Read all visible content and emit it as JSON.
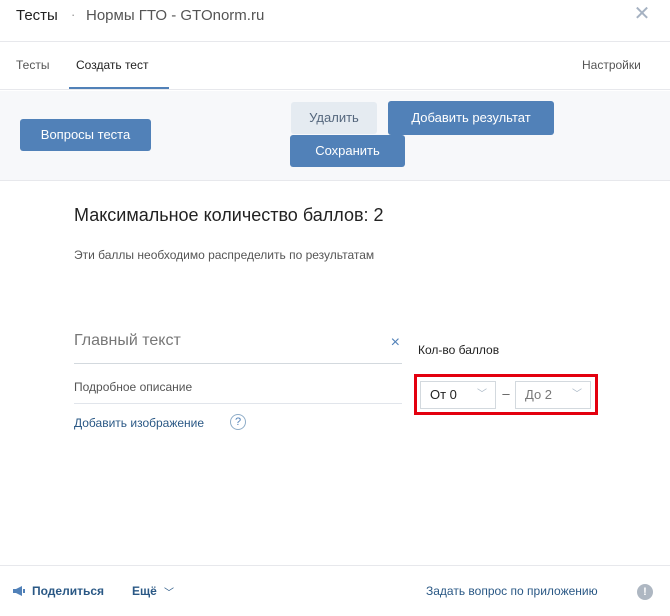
{
  "header": {
    "title": "Тесты",
    "separator": "·",
    "app_name": "Нормы ГТО - GTOnorm.ru",
    "close_icon": "close-icon"
  },
  "tabs": {
    "items": [
      {
        "label": "Тесты"
      },
      {
        "label": "Создать тест",
        "active": true
      },
      {
        "label": "Настройки"
      }
    ]
  },
  "toolbar": {
    "questions_label": "Вопросы теста",
    "delete_label": "Удалить",
    "add_result_label": "Добавить результат",
    "save_label": "Сохранить"
  },
  "content": {
    "max_score": "Максимальное количество баллов: 2",
    "hint": "Эти баллы необходимо распределить по результатам",
    "main_text_placeholder": "Главный текст",
    "clear_icon": "×",
    "description_placeholder": "Подробное описание",
    "add_image_label": "Добавить изображение",
    "help_icon": "?",
    "score_label": "Кол-во баллов",
    "from_value": "От 0",
    "dash": "–",
    "to_value": "До 2"
  },
  "footer": {
    "share_label": "Поделиться",
    "more_label": "Ещё",
    "ask_label": "Задать вопрос по приложению",
    "info_icon": "!"
  },
  "colors": {
    "accent": "#5181b8",
    "link": "#2a5885",
    "highlight": "#e3000f"
  }
}
